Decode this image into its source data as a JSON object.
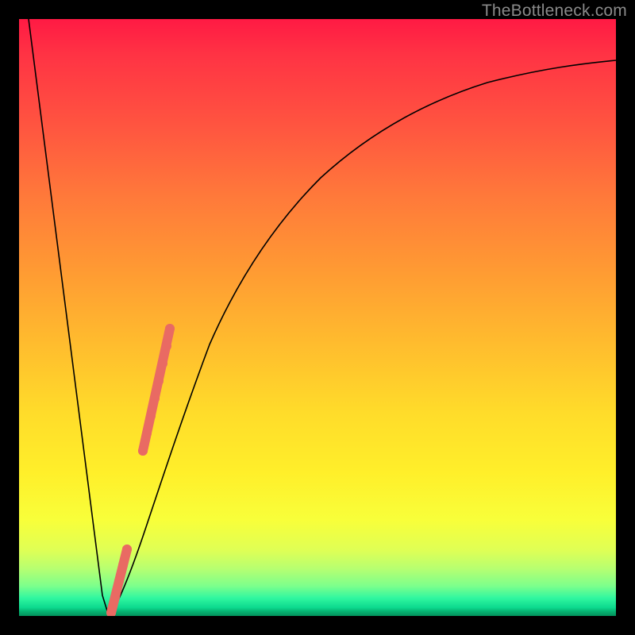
{
  "watermark": "TheBottleneck.com",
  "colors": {
    "frame": "#000000",
    "curve": "#000000",
    "highlight": "#e96a63",
    "watermark": "#8a8a8a"
  },
  "chart_data": {
    "type": "line",
    "title": "",
    "xlabel": "",
    "ylabel": "",
    "xlim": [
      0,
      100
    ],
    "ylim": [
      0,
      100
    ],
    "grid": false,
    "legend": false,
    "series": [
      {
        "name": "bottleneck-curve",
        "x": [
          0,
          3,
          6,
          9,
          11,
          12.5,
          13.5,
          14.5,
          16,
          18,
          20,
          22,
          24,
          27,
          30,
          34,
          38,
          44,
          50,
          58,
          66,
          76,
          88,
          100
        ],
        "y": [
          100,
          84,
          66,
          44,
          26,
          12,
          3,
          0,
          6,
          16,
          28,
          38,
          47,
          57,
          64,
          71,
          76,
          81,
          84.5,
          87.5,
          89.5,
          91,
          92,
          92.5
        ]
      }
    ],
    "highlights": [
      {
        "name": "upper-highlight",
        "approx_x_range": [
          20,
          24.2
        ],
        "approx_y_range": [
          28,
          48
        ]
      },
      {
        "name": "lower-highlight",
        "approx_x_range": [
          14.5,
          17.5
        ],
        "approx_y_range": [
          0,
          11
        ]
      }
    ],
    "annotations": []
  }
}
